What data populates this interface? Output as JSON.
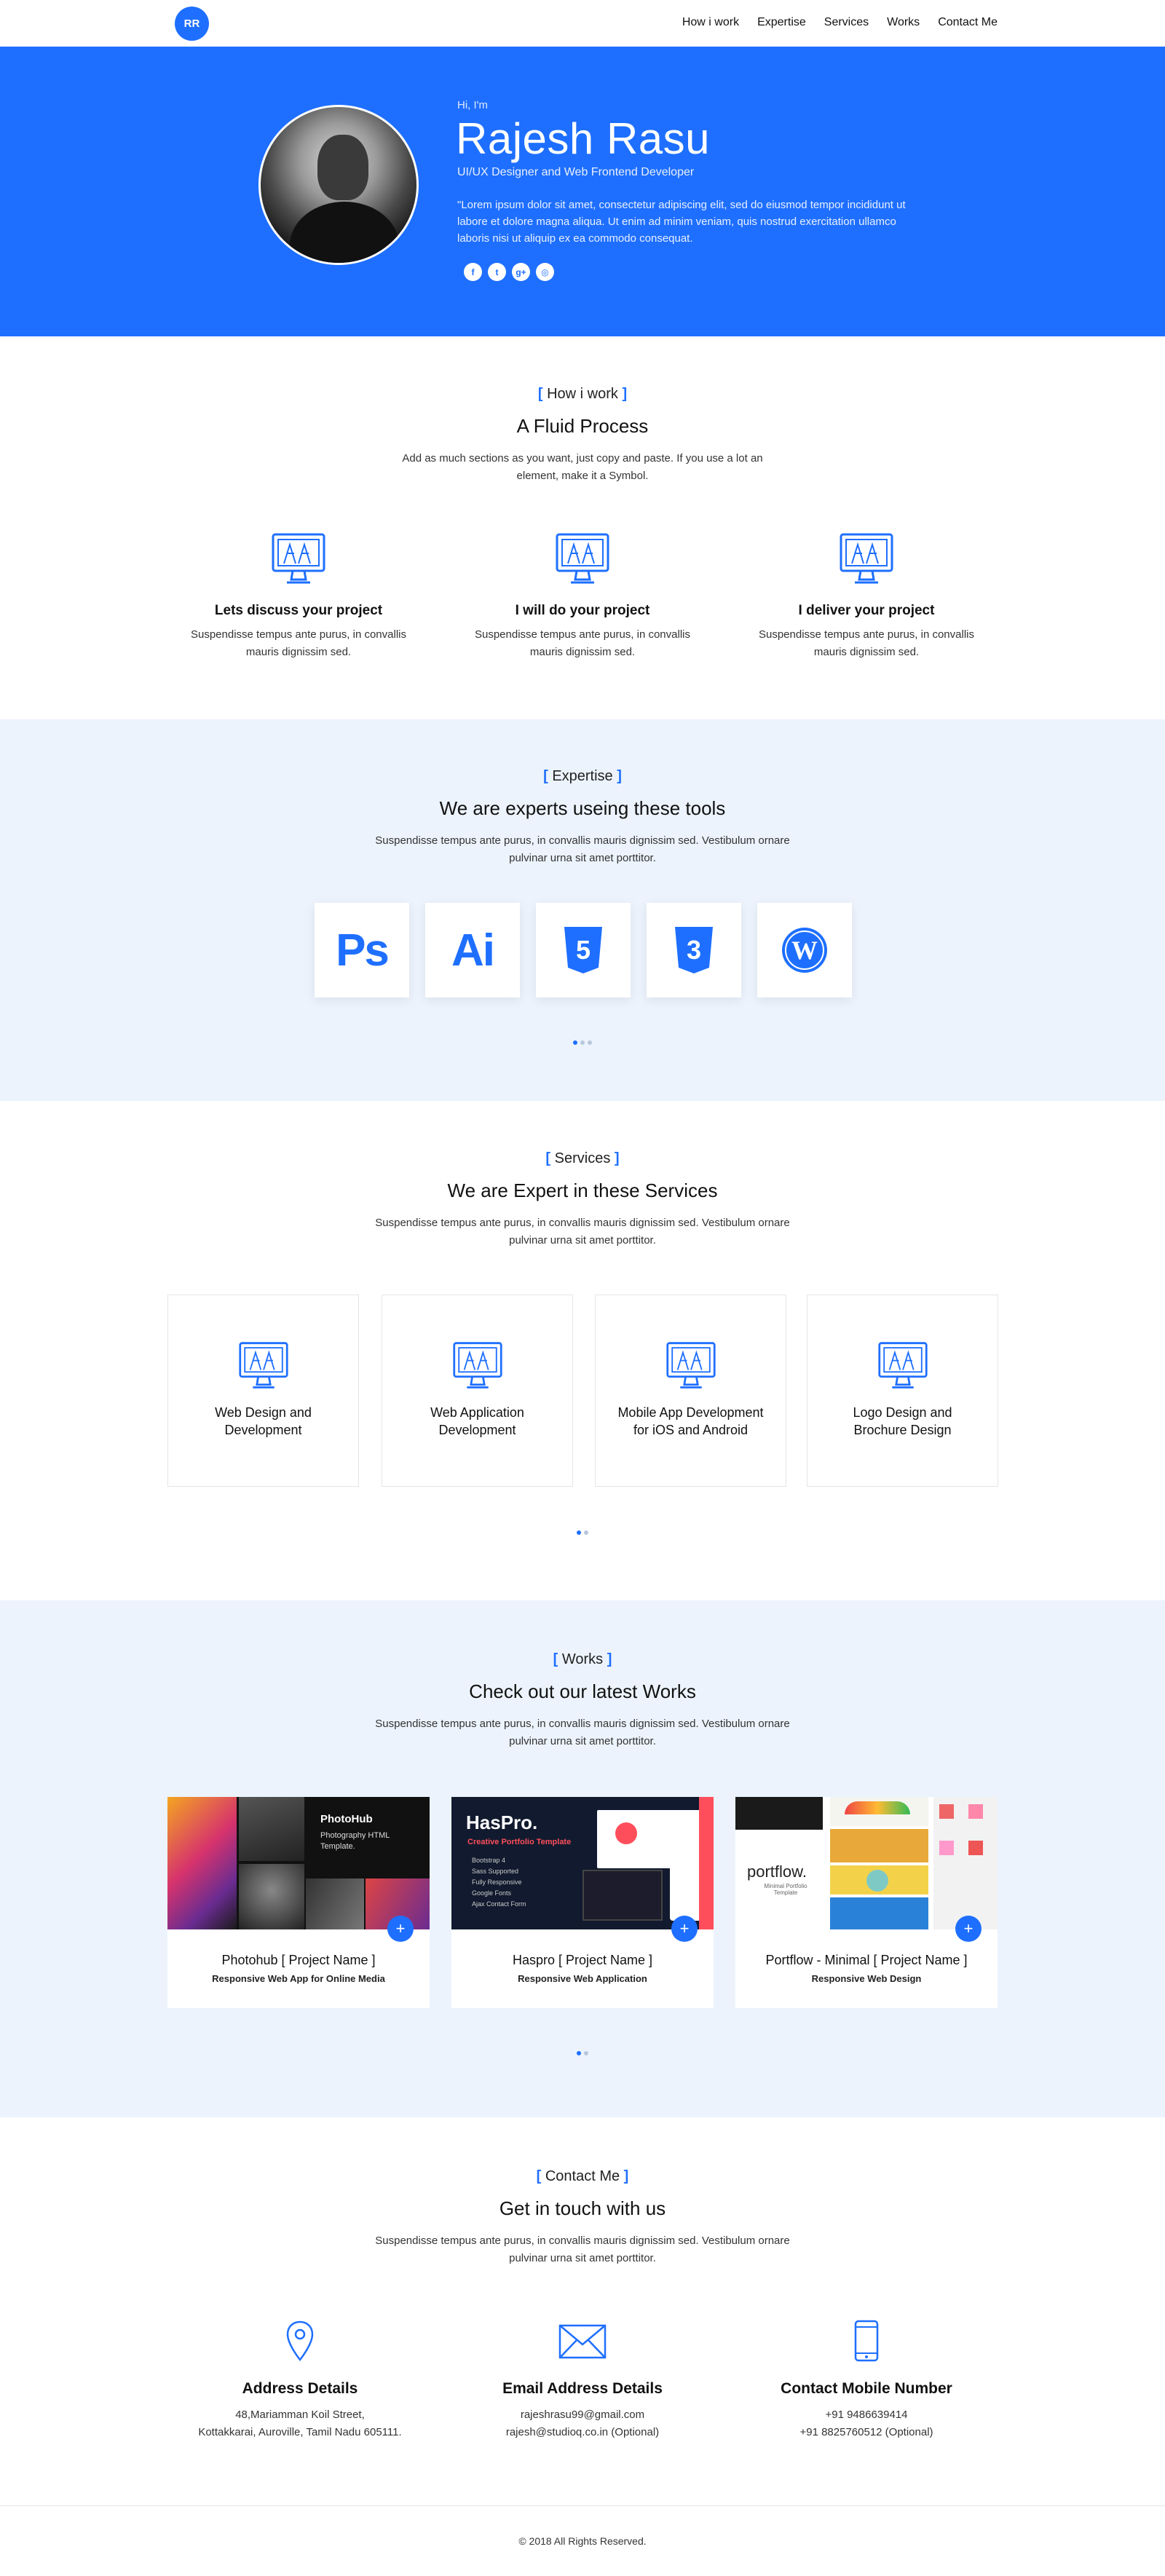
{
  "nav": {
    "logo": "RR",
    "links": [
      "How i work",
      "Expertise",
      "Services",
      "Works",
      "Contact Me"
    ]
  },
  "hero": {
    "greeting": "Hi, I'm",
    "name": "Rajesh Rasu",
    "role": "UI/UX Designer and Web Frontend Developer",
    "quote": "\"Lorem ipsum dolor sit amet, consectetur adipiscing elit, sed do eiusmod tempor incididunt ut labore et dolore magna aliqua. Ut enim ad minim veniam, quis nostrud exercitation ullamco laboris nisi ut aliquip ex ea commodo consequat.",
    "socials": [
      "facebook-icon",
      "twitter-icon",
      "google-plus-icon",
      "instagram-icon"
    ]
  },
  "how": {
    "tag": "How i work",
    "title": "A Fluid Process",
    "desc": "Add as much sections as you want, just copy and paste. If you use a lot an element, make it a Symbol.",
    "steps": [
      {
        "title": "Lets discuss your project",
        "desc": "Suspendisse tempus ante purus, in convallis mauris dignissim sed."
      },
      {
        "title": "I will do your project",
        "desc": "Suspendisse tempus ante purus, in convallis mauris dignissim sed."
      },
      {
        "title": "I deliver your project",
        "desc": "Suspendisse tempus ante purus, in convallis mauris dignissim sed."
      }
    ]
  },
  "expertise": {
    "tag": "Expertise",
    "title": "We are experts useing these tools",
    "desc": "Suspendisse tempus ante purus, in convallis mauris dignissim sed. Vestibulum ornare pulvinar urna sit amet porttitor.",
    "tools": [
      {
        "label": "Ps",
        "icon": "photoshop-icon"
      },
      {
        "label": "Ai",
        "icon": "illustrator-icon"
      },
      {
        "label": "5",
        "icon": "html5-icon"
      },
      {
        "label": "3",
        "icon": "css3-icon"
      },
      {
        "label": "W",
        "icon": "wordpress-icon"
      }
    ]
  },
  "services": {
    "tag": "Services",
    "title": "We are Expert in these Services",
    "desc": "Suspendisse tempus ante purus, in convallis mauris dignissim sed. Vestibulum ornare pulvinar urna sit amet porttitor.",
    "items": [
      {
        "line1": "Web Design and",
        "line2": "Development"
      },
      {
        "line1": "Web Application",
        "line2": "Development"
      },
      {
        "line1": "Mobile App Development",
        "line2": "for iOS and Android"
      },
      {
        "line1": "Logo Design and",
        "line2": "Brochure Design"
      }
    ]
  },
  "works": {
    "tag": "Works",
    "title": "Check out our latest Works",
    "desc": "Suspendisse tempus ante purus, in convallis mauris dignissim sed. Vestibulum ornare pulvinar urna sit amet porttitor.",
    "items": [
      {
        "name": "Photohub [ Project Name ]",
        "sub": "Responsive Web App for Online Media",
        "thumb_title": "PhotoHub",
        "thumb_text": "Photography HTML Template."
      },
      {
        "name": "Haspro [ Project Name ]",
        "sub": "Responsive Web Application",
        "thumb_title": "HasPro.",
        "thumb_text": "Creative Portfolio Template",
        "thumb_list": [
          "Bootstrap 4",
          "Sass Supported",
          "Fully Responsive",
          "Google Fonts",
          "Ajax Contact Form"
        ]
      },
      {
        "name": "Portflow - Minimal [ Project Name ]",
        "sub": "Responsive Web Design",
        "thumb_title": "portflow.",
        "thumb_text": "Minimal Portfolio Template"
      }
    ]
  },
  "contact": {
    "tag": "Contact Me",
    "title": "Get in touch with us",
    "desc": "Suspendisse tempus ante purus, in convallis mauris dignissim sed. Vestibulum ornare pulvinar urna sit amet porttitor.",
    "blocks": [
      {
        "title": "Address Details",
        "line1": "48,Mariamman Koil Street,",
        "line2": "Kottakkarai, Auroville, Tamil Nadu 605111."
      },
      {
        "title": "Email Address Details",
        "line1": "rajeshrasu99@gmail.com",
        "line2": "rajesh@studioq.co.in (Optional)"
      },
      {
        "title": "Contact Mobile Number",
        "line1": "+91 9486639414",
        "line2": "+91 8825760512 (Optional)"
      }
    ]
  },
  "footer": {
    "text": "© 2018 All Rights Reserved."
  },
  "colors": {
    "accent": "#1e6fff",
    "section_bg": "#ecf3fc"
  }
}
